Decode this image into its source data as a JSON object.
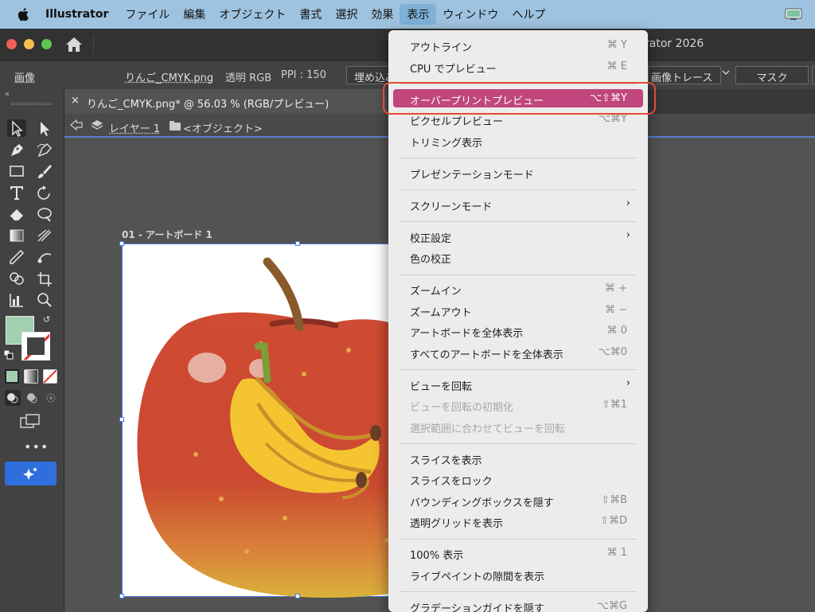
{
  "menubar": {
    "app_name": "Illustrator",
    "items": [
      "ファイル",
      "編集",
      "オブジェクト",
      "書式",
      "選択",
      "効果",
      "表示",
      "ウィンドウ",
      "ヘルプ"
    ],
    "active_item": "表示",
    "icons": {
      "apple": "apple-icon",
      "status": "display-status-icon"
    }
  },
  "titlebar": {
    "window_title": "rator 2026",
    "icons": {
      "home": "home-icon"
    }
  },
  "controlbar": {
    "object_type": "画像",
    "filename": "りんご_CMYK.png",
    "color_mode": "透明 RGB",
    "ppi": "PPI : 150",
    "embed_label": "埋め込み",
    "trace_label": "画像トレース",
    "mask_label": "マスク"
  },
  "tools": {
    "items": [
      "selection-tool",
      "direct-selection-tool",
      "pen-tool",
      "curvature-tool",
      "rectangle-tool",
      "paintbrush-tool",
      "type-tool",
      "rotate-tool",
      "eraser-tool",
      "warp-tool",
      "gradient-tool",
      "eyedropper-tool",
      "shape-builder-tool",
      "artboard-tool",
      "graph-tool",
      "zoom-tool"
    ],
    "fill_color": "#a2cfb0",
    "stroke_color": "none",
    "more_label": "•••"
  },
  "document": {
    "tab_close": "×",
    "tab_label": "りんご_CMYK.png* @ 56.03 % (RGB/プレビュー)",
    "layer_label": "レイヤー 1",
    "object_label": "<オブジェクト>",
    "artboard_label": "01 - アートボード 1"
  },
  "view_menu": {
    "highlight_color": "#c0467d",
    "groups": [
      [
        {
          "label": "アウトライン",
          "shortcut": "⌘ Y"
        },
        {
          "label": "CPU でプレビュー",
          "shortcut": "⌘ E"
        }
      ],
      [
        {
          "label": "オーバープリントプレビュー",
          "shortcut": "⌥⇧⌘Y",
          "highlighted": true
        },
        {
          "label": "ピクセルプレビュー",
          "shortcut": "⌥⌘Y"
        },
        {
          "label": "トリミング表示",
          "shortcut": ""
        }
      ],
      [
        {
          "label": "プレゼンテーションモード",
          "shortcut": ""
        }
      ],
      [
        {
          "label": "スクリーンモード",
          "shortcut": "",
          "submenu": true
        }
      ],
      [
        {
          "label": "校正設定",
          "shortcut": "",
          "submenu": true
        },
        {
          "label": "色の校正",
          "shortcut": ""
        }
      ],
      [
        {
          "label": "ズームイン",
          "shortcut": "⌘ +"
        },
        {
          "label": "ズームアウト",
          "shortcut": "⌘ −"
        },
        {
          "label": "アートボードを全体表示",
          "shortcut": "⌘ 0"
        },
        {
          "label": "すべてのアートボードを全体表示",
          "shortcut": "⌥⌘0"
        }
      ],
      [
        {
          "label": "ビューを回転",
          "shortcut": "",
          "submenu": true
        },
        {
          "label": "ビューを回転の初期化",
          "shortcut": "⇧⌘1",
          "disabled": true
        },
        {
          "label": "選択範囲に合わせてビューを回転",
          "shortcut": "",
          "disabled": true
        }
      ],
      [
        {
          "label": "スライスを表示",
          "shortcut": ""
        },
        {
          "label": "スライスをロック",
          "shortcut": ""
        },
        {
          "label": "バウンディングボックスを隠す",
          "shortcut": "⇧⌘B"
        },
        {
          "label": "透明グリッドを表示",
          "shortcut": "⇧⌘D"
        }
      ],
      [
        {
          "label": "100% 表示",
          "shortcut": "⌘ 1"
        },
        {
          "label": "ライブペイントの隙間を表示",
          "shortcut": ""
        }
      ],
      [
        {
          "label": "グラデーションガイドを隠す",
          "shortcut": "⌥⌘G"
        }
      ]
    ],
    "submenu_arrow": "›"
  }
}
